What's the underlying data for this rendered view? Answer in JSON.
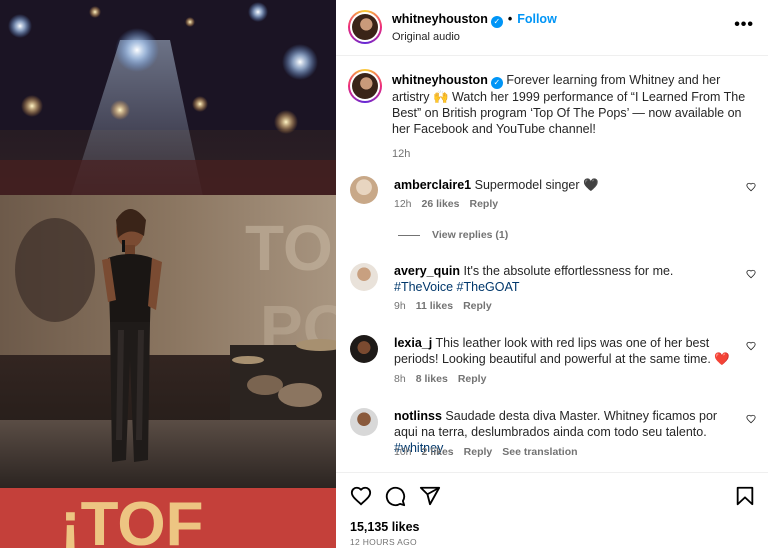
{
  "header": {
    "username": "whitneyhouston",
    "verified_icon": "verified-badge-icon",
    "separator": "•",
    "follow_label": "Follow",
    "audio_label": "Original audio",
    "more_icon": "•••"
  },
  "caption": {
    "username": "whitneyhouston",
    "text": "Forever learning from Whitney and her artistry 🙌 Watch her 1999 performance of “I Learned From The Best” on British program ‘Top Of The Pops’ — now available on her Facebook and YouTube channel!",
    "time": "12h"
  },
  "comments": [
    {
      "username": "amberclaire1",
      "text": "Supermodel singer 🖤",
      "tags": "",
      "time": "12h",
      "likes": "26 likes",
      "reply": "Reply",
      "translation": "",
      "view_replies": "View replies (1)"
    },
    {
      "username": "avery_quin",
      "text": "It's the absolute effortlessness for me.",
      "tags": "#TheVoice #TheGOAT",
      "time": "9h",
      "likes": "11 likes",
      "reply": "Reply",
      "translation": "",
      "view_replies": ""
    },
    {
      "username": "lexia_j",
      "text": "This leather look with red lips was one of her best periods! Looking beautiful and powerful at the same time. ❤️",
      "tags": "",
      "time": "8h",
      "likes": "8 likes",
      "reply": "Reply",
      "translation": "",
      "view_replies": ""
    },
    {
      "username": "notlinss",
      "text": "Saudade desta diva Master. Whitney ficamos por aqui na terra, deslumbrados ainda com todo seu talento.",
      "tags": "#whitney",
      "time": "10h",
      "likes": "2 likes",
      "reply": "Reply",
      "translation": "See translation",
      "view_replies": ""
    }
  ],
  "actions": {
    "like_icon": "heart-icon",
    "comment_icon": "comment-icon",
    "share_icon": "share-icon",
    "save_icon": "bookmark-icon",
    "likes_count": "15,135 likes",
    "posted": "12 HOURS AGO"
  },
  "colors": {
    "link_blue": "#0095f6",
    "tag_blue": "#00376b",
    "muted": "#737373",
    "heart_red": "#ff3040"
  }
}
